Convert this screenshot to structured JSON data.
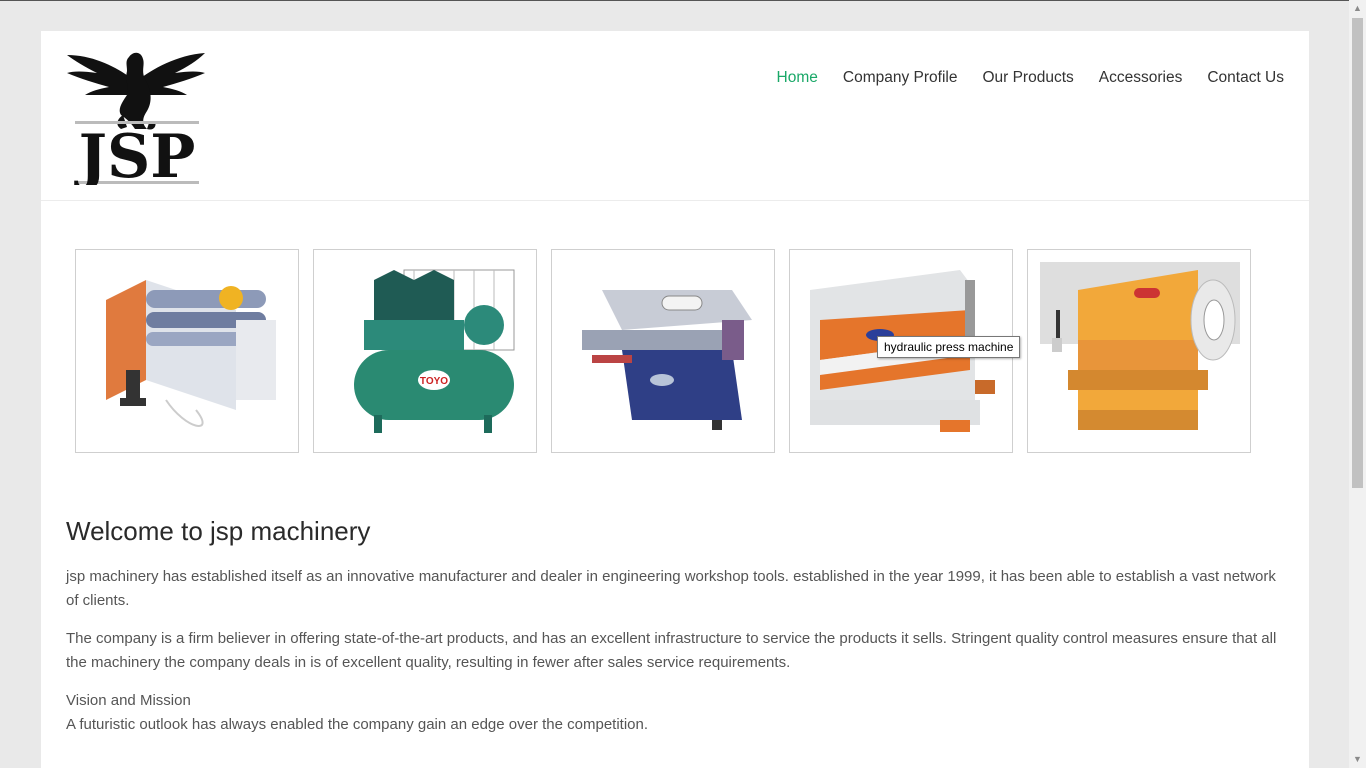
{
  "nav": {
    "items": [
      {
        "label": "Home",
        "active": true
      },
      {
        "label": "Company Profile",
        "active": false
      },
      {
        "label": "Our Products",
        "active": false
      },
      {
        "label": "Accessories",
        "active": false
      },
      {
        "label": "Contact Us",
        "active": false
      }
    ],
    "active_color": "#1aa868"
  },
  "logo": {
    "text": "JSP",
    "icon": "pegasus-logo-icon"
  },
  "gallery": [
    {
      "name": "plate-rolling-machine"
    },
    {
      "name": "air-compressor",
      "badge": "TOYO"
    },
    {
      "name": "bandsaw-machine"
    },
    {
      "name": "press-brake-machine"
    },
    {
      "name": "power-press-machine"
    }
  ],
  "tooltip": {
    "text": "hydraulic press machine"
  },
  "content": {
    "heading": "Welcome to jsp machinery",
    "para1": "jsp machinery has established itself as an innovative manufacturer and dealer in engineering workshop tools. established in the year 1999, it has been able to establish a vast network of clients.",
    "para2": "The company is a firm believer in offering state-of-the-art products, and has an excellent infrastructure to service the products it sells. Stringent quality control measures ensure that all the machinery the company deals in is of excellent quality, resulting in fewer after sales service requirements.",
    "vision_title": "Vision and Mission",
    "vision_text": "A futuristic outlook has always enabled the company gain an edge over the competition."
  }
}
